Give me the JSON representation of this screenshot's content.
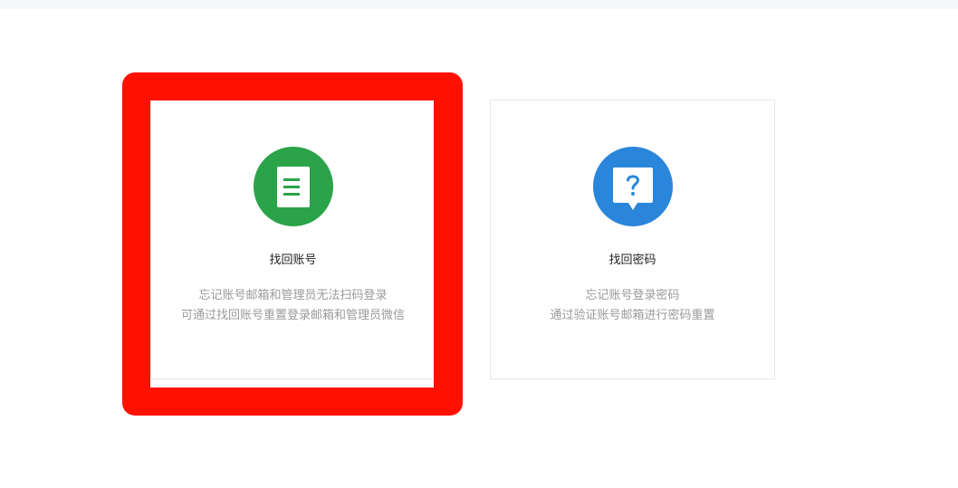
{
  "options": [
    {
      "title": "找回账号",
      "desc_line1": "忘记账号邮箱和管理员无法扫码登录",
      "desc_line2": "可通过找回账号重置登录邮箱和管理员微信",
      "icon": "document-icon",
      "color": "#2ba349"
    },
    {
      "title": "找回密码",
      "desc_line1": "忘记账号登录密码",
      "desc_line2": "通过验证账号邮箱进行密码重置",
      "icon": "question-icon",
      "color": "#2a86db"
    }
  ],
  "highlight_color": "#ff1100"
}
